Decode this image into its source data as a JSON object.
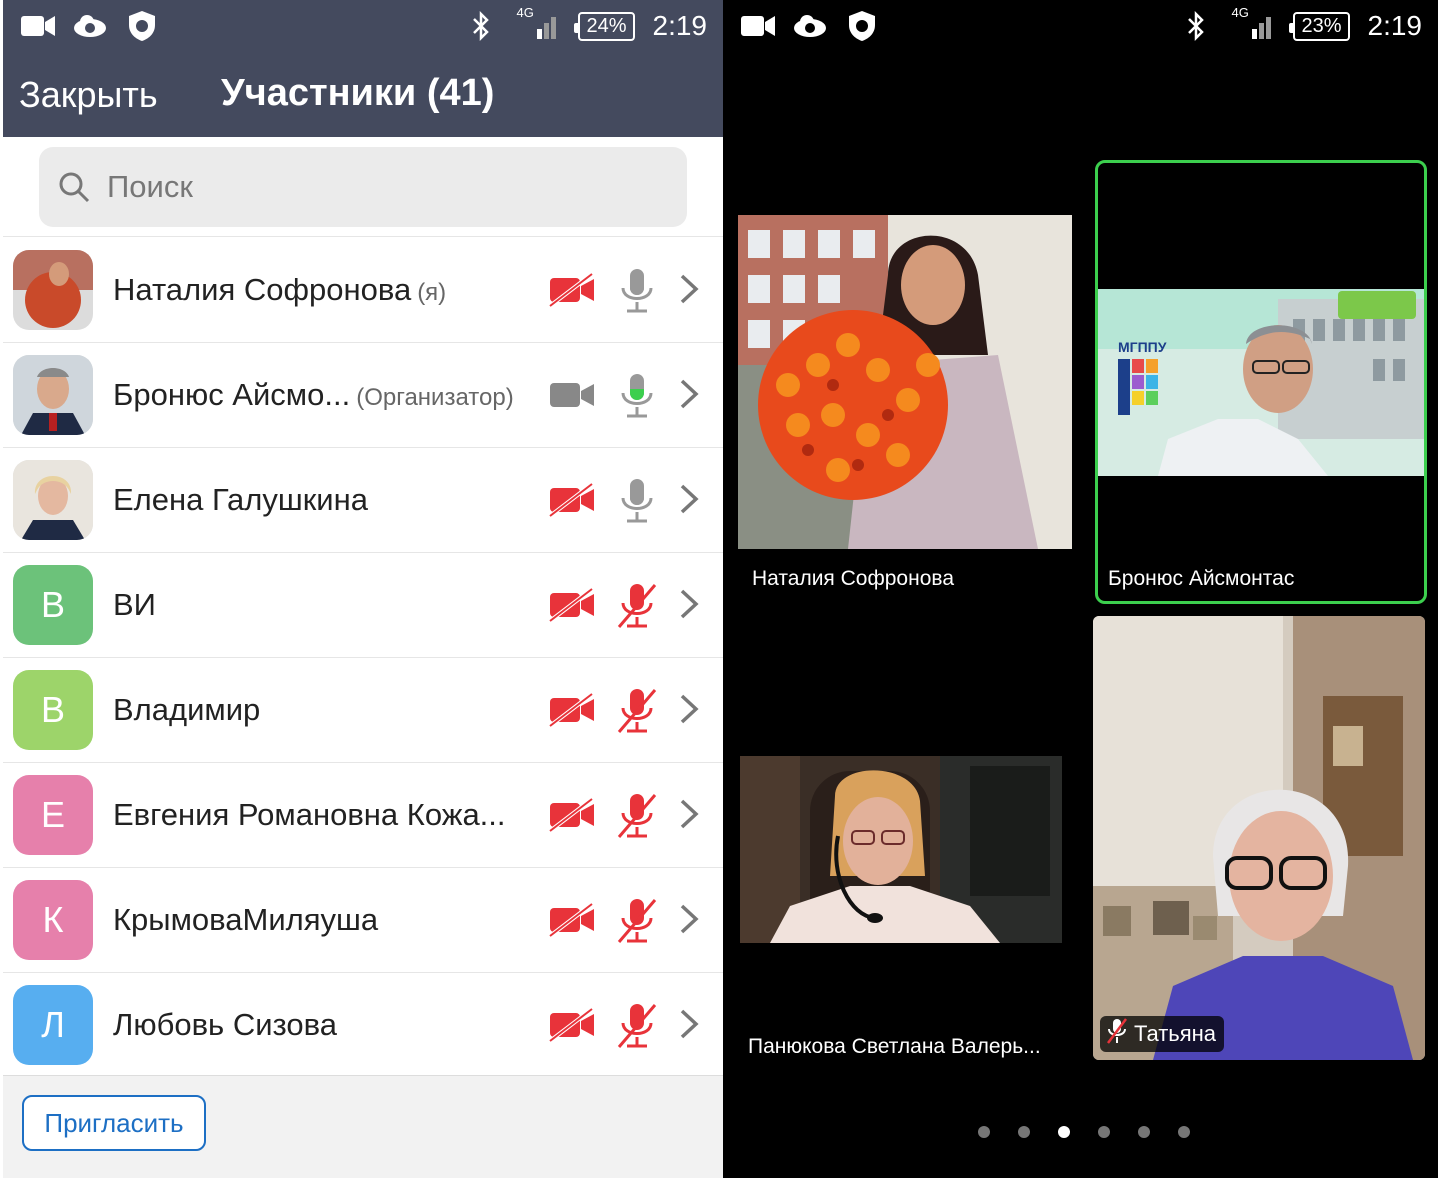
{
  "left": {
    "status": {
      "time": "2:19",
      "battery": "24%",
      "network": "4G"
    },
    "nav": {
      "close_label": "Закрыть",
      "title": "Участники (41)"
    },
    "search": {
      "placeholder": "Поиск"
    },
    "participants": [
      {
        "name": "Наталия Софронова",
        "tag": "(я)",
        "avatar_letter": "",
        "avatar_color": "#c94a2a",
        "camera": "off",
        "mic": "on"
      },
      {
        "name": "Бронюс Айсмо...",
        "tag": "(Организатор)",
        "avatar_letter": "",
        "avatar_color": "#7a8a99",
        "camera": "on",
        "mic": "active"
      },
      {
        "name": "Елена Галушкина",
        "tag": "",
        "avatar_letter": "",
        "avatar_color": "#b9a68c",
        "camera": "off",
        "mic": "on"
      },
      {
        "name": "ВИ",
        "tag": "",
        "avatar_letter": "В",
        "avatar_color": "#6cc27a",
        "camera": "off",
        "mic": "muted"
      },
      {
        "name": "Владимир",
        "tag": "",
        "avatar_letter": "В",
        "avatar_color": "#9dd46a",
        "camera": "off",
        "mic": "muted"
      },
      {
        "name": "Евгения Романовна Кожа...",
        "tag": "",
        "avatar_letter": "Е",
        "avatar_color": "#e680ab",
        "camera": "off",
        "mic": "muted"
      },
      {
        "name": "КрымоваМиляуша",
        "tag": "",
        "avatar_letter": "К",
        "avatar_color": "#e680ab",
        "camera": "off",
        "mic": "muted"
      },
      {
        "name": "Любовь Сизова",
        "tag": "",
        "avatar_letter": "Л",
        "avatar_color": "#57aef0",
        "camera": "off",
        "mic": "muted"
      }
    ],
    "invite_label": "Пригласить"
  },
  "right": {
    "status": {
      "time": "2:19",
      "battery": "23%",
      "network": "4G"
    },
    "tiles": {
      "t1_name": "Наталия Софронова",
      "t2_name": "Бронюс Айсмонтас",
      "t2_logo": "МГППУ",
      "t3_name": "Панюкова Светлана Валерь...",
      "t4_name": "Татьяна"
    },
    "pages": {
      "count": 6,
      "active_index": 2
    }
  },
  "colors": {
    "muted_red": "#e8333a",
    "active_green": "#3ccf4e",
    "nav_bg": "#444a5e",
    "accent_blue": "#1d6fc4"
  }
}
